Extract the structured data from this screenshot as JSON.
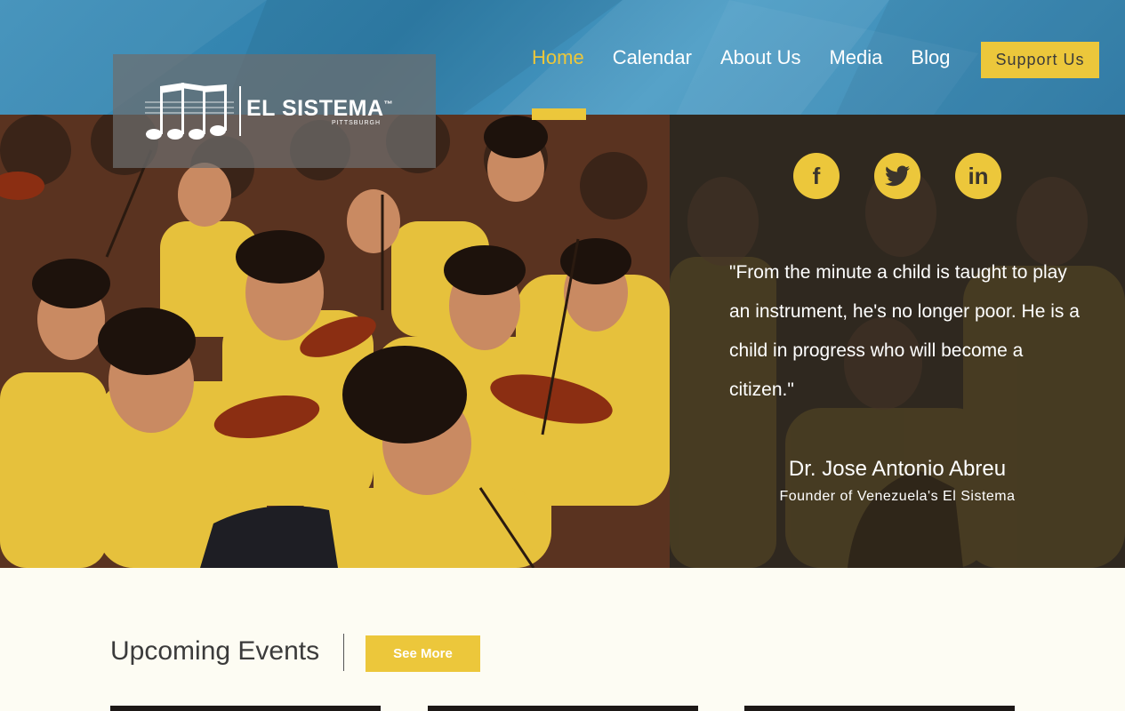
{
  "header": {
    "logo": {
      "brand": "EL SISTEMA",
      "trademark": "™",
      "city": "PITTSBURGH",
      "icon": "music-notes-icon"
    },
    "nav": [
      {
        "label": "Home",
        "active": true
      },
      {
        "label": "Calendar",
        "active": false
      },
      {
        "label": "About Us",
        "active": false
      },
      {
        "label": "Media",
        "active": false
      },
      {
        "label": "Blog",
        "active": false
      }
    ],
    "support_label": "Support Us"
  },
  "hero": {
    "social": [
      {
        "icon": "facebook-icon",
        "glyph": "f"
      },
      {
        "icon": "twitter-icon",
        "glyph": "🐦"
      },
      {
        "icon": "linkedin-icon",
        "glyph": "in"
      }
    ],
    "quote": "\"From the minute a child is taught to play an instrument, he's no longer poor. He is a child in progress who will become a citizen.\"",
    "author": "Dr. Jose Antonio Abreu",
    "author_role": "Founder of Venezuela's El Sistema"
  },
  "events": {
    "title": "Upcoming Events",
    "see_more_label": "See More"
  },
  "colors": {
    "accent": "#ecc73b",
    "header_blue": "#3d8fb9",
    "background": "#fdfcf3"
  }
}
